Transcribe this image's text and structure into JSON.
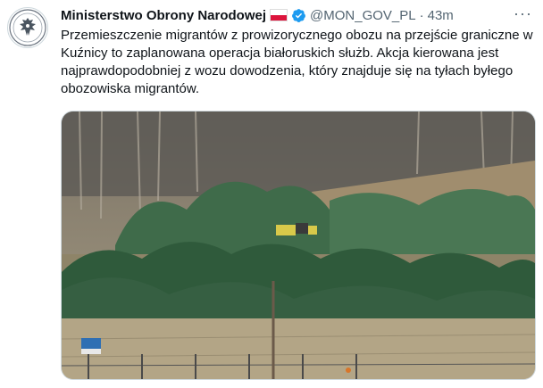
{
  "tweet": {
    "author_name": "Ministerstwo Obrony Narodowej",
    "handle": "@MON_GOV_PL",
    "separator": "·",
    "time": "43m",
    "more_icon": "more-horizontal-icon",
    "text": "Przemieszczenie migrantów z prowizorycznego obozu na przejście graniczne w Kuźnicy to zaplanowana operacja białoruskich służb. Akcja kierowana jest najprawdopodobniej z wozu dowodzenia, który znajduje się na tyłach byłego obozowiska migrantów.",
    "colors": {
      "verified": "#1d9bf0",
      "flag_red": "#dc143c",
      "secondary_text": "#536471"
    }
  }
}
